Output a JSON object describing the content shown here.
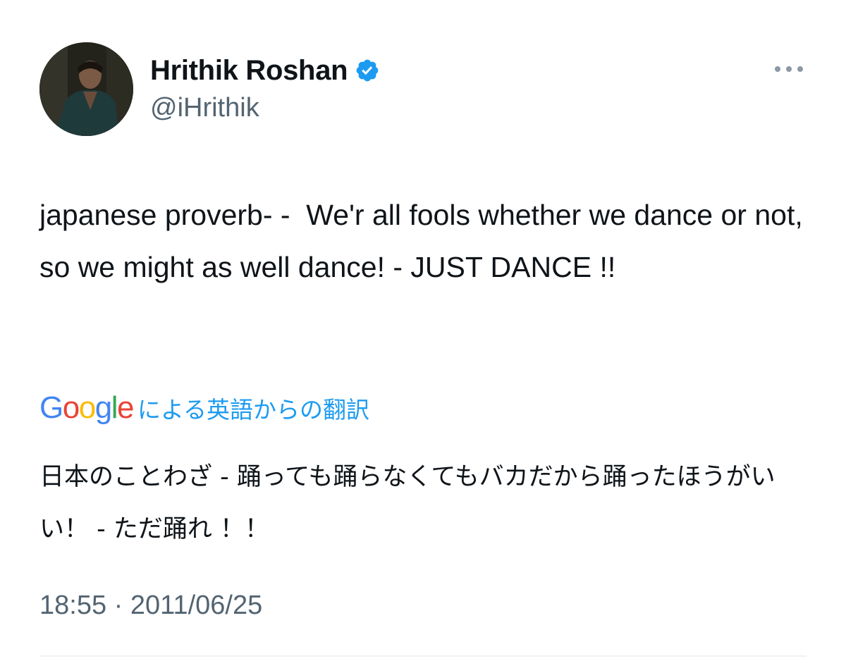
{
  "user": {
    "display_name": "Hrithik Roshan",
    "handle": "@iHrithik",
    "verified": true
  },
  "tweet": {
    "text": "japanese proverb- -  We'r all fools whether we dance or not, so we might as well dance! - JUST DANCE !!",
    "timestamp": "18:55 · 2011/06/25"
  },
  "translation": {
    "provider_logo": [
      "G",
      "o",
      "o",
      "g",
      "l",
      "e"
    ],
    "provider_logo_colors": [
      "#4285F4",
      "#EA4335",
      "#FBBC05",
      "#4285F4",
      "#34A853",
      "#EA4335"
    ],
    "label": "による英語からの翻訳",
    "text": "日本のことわざ - 踊っても踊らなくてもバカだから踊ったほうがいい！ - ただ踊れ ！！"
  },
  "icons": {
    "verified": "verified-badge-icon",
    "more": "more-options-icon"
  },
  "colors": {
    "verified_blue": "#1d9bf0",
    "secondary_text": "#536471",
    "primary_text": "#0f1419"
  }
}
